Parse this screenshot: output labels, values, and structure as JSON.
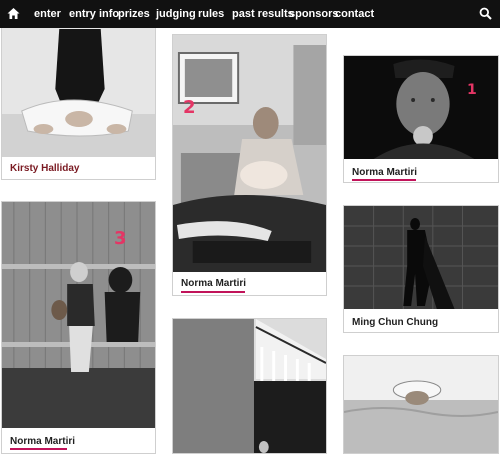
{
  "nav": {
    "home_icon": "home-icon",
    "search_icon": "search-icon",
    "items": [
      {
        "label": "enter"
      },
      {
        "label": "entry info"
      },
      {
        "label": "prizes"
      },
      {
        "label": "judging"
      },
      {
        "label": "rules"
      },
      {
        "label": "past results"
      },
      {
        "label": "sponsors"
      },
      {
        "label": "contact"
      }
    ]
  },
  "gallery": {
    "cards": [
      {
        "caption": "Kirsty Halliday",
        "badge": ""
      },
      {
        "caption": "Norma Martiri",
        "badge": "2"
      },
      {
        "caption": "Norma Martiri",
        "badge": "1"
      },
      {
        "caption": "Norma Martiri",
        "badge": "3"
      },
      {
        "caption": "Ming Chun Chung",
        "badge": ""
      },
      {
        "caption": "",
        "badge": ""
      },
      {
        "caption": "",
        "badge": ""
      }
    ]
  },
  "colors": {
    "nav_bg": "#111111",
    "caption_red": "#7a1a22",
    "underline": "#c1135a",
    "badge": "#e43565"
  }
}
